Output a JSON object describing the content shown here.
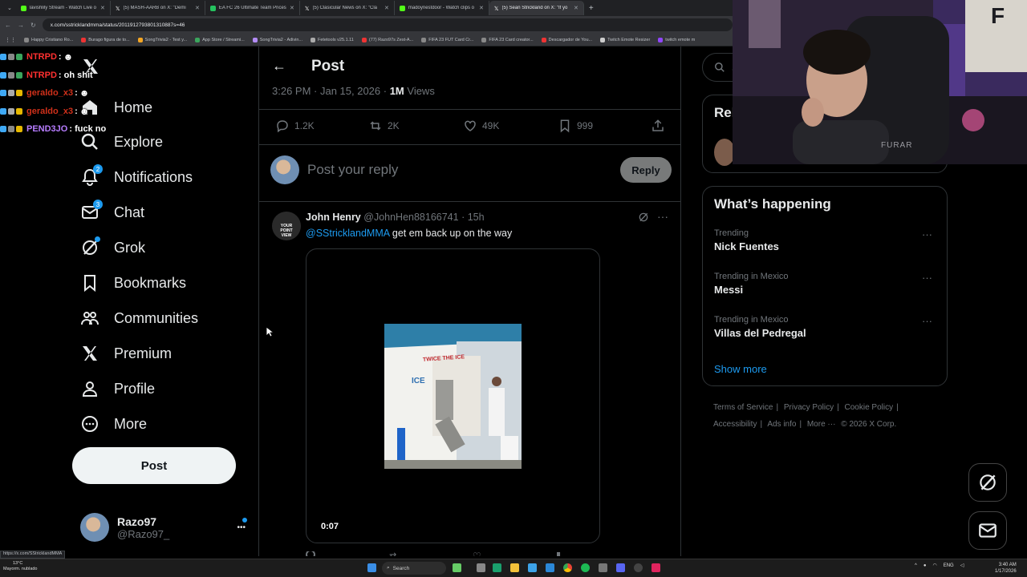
{
  "browser": {
    "tabs": [
      {
        "label": "lavishlily Stream - Watch Live o",
        "color": "#53fc18"
      },
      {
        "label": "(5) MASH-AARB on X: \"Demi",
        "color": "#ffffff"
      },
      {
        "label": "EA FC 26 Ultimate Team Prices",
        "color": "#25c35f"
      },
      {
        "label": "(5) Clasicular News on X: \"Cla",
        "color": "#ffffff"
      },
      {
        "label": "madoynestdoor - Watch clips o",
        "color": "#53fc18"
      },
      {
        "label": "(5) Sean Strickland on X: \"If yo",
        "color": "#ffffff"
      }
    ],
    "new_tab": "+",
    "url": "x.com/sstricklandmma/status/2011912793801310887s=46",
    "bookmarks": [
      "Happy Cristiano Ro...",
      "Burago figura de to...",
      "SongTrivia2 - Test y...",
      "App Store / Streami...",
      "SongTrivia2 - Adivin...",
      "Fetetools v25.1.11",
      "(77) Razo97s Zest-A...",
      "FIFA 23 FUT Card Cr...",
      "FIFA 23 Card creator...",
      "Descargador de You...",
      "Twitch Emote Resizer",
      "twitch emote m"
    ],
    "status_url": "https://x.com/SStricklandMMA"
  },
  "chat": [
    {
      "user": "NTRPD",
      "msg": ":",
      "color": "#ff3030"
    },
    {
      "user": "NTRPD",
      "msg": ": oh shit",
      "color": "#ff3030"
    },
    {
      "user": "geraldo_x3",
      "msg": ":",
      "color": "#d0301a"
    },
    {
      "user": "geraldo_x3",
      "msg": ":",
      "color": "#d0301a"
    },
    {
      "user": "PEND3JO",
      "msg": ": fuck no",
      "color": "#b77dff"
    }
  ],
  "nav": {
    "items": [
      {
        "label": "Home"
      },
      {
        "label": "Explore"
      },
      {
        "label": "Notifications",
        "badge": "2"
      },
      {
        "label": "Chat",
        "badge": "3"
      },
      {
        "label": "Grok"
      },
      {
        "label": "Bookmarks"
      },
      {
        "label": "Communities"
      },
      {
        "label": "Premium"
      },
      {
        "label": "Profile"
      },
      {
        "label": "More"
      }
    ],
    "post_label": "Post",
    "account_name": "Razo97",
    "account_handle": "@Razo97_",
    "account_more": "•••"
  },
  "main": {
    "title": "Post",
    "meta_time": "3:26 PM · Jan 15, 2026 · ",
    "meta_views_count": "1M",
    "meta_views_label": " Views",
    "stats": {
      "replies": "1.2K",
      "reposts": "2K",
      "likes": "49K",
      "bookmarks": "999"
    },
    "reply_placeholder": "Post your reply",
    "reply_button": "Reply",
    "tweet": {
      "name": "John Henry",
      "handle": "@JohnHen88166741",
      "sep": " · ",
      "time": "15h",
      "mention": "@SStricklandMMA",
      "text": " get em back up on the way",
      "avatar_text": "YOUR POINT VIEW",
      "menu": "···",
      "media_sign": "TWICE THE ICE",
      "media_side": "ICE",
      "duration": "0:07"
    }
  },
  "right": {
    "search_placeholder": "Se",
    "relevant_title": "Rel",
    "happening_title": "What’s happening",
    "trends": [
      {
        "context": "Trending",
        "name": "Nick Fuentes"
      },
      {
        "context": "Trending in Mexico",
        "name": "Messi"
      },
      {
        "context": "Trending in Mexico",
        "name": "Villas del Pedregal"
      }
    ],
    "trend_menu": "···",
    "show_more": "Show more",
    "footer": [
      "Terms of Service",
      "|",
      "Privacy Policy",
      "|",
      "Cookie Policy",
      "|",
      "Accessibility",
      "|",
      "Ads info",
      "|",
      "More ···",
      "© 2026 X Corp."
    ]
  },
  "taskbar": {
    "weather_temp": "13°C",
    "weather_desc": "Mayorm. nublado",
    "search": "Search",
    "tray_lang": "ENG",
    "time": "3:40 AM",
    "date": "1/17/2026"
  },
  "webcam": {
    "chair_text": "FURAR",
    "wall_text": "F"
  }
}
